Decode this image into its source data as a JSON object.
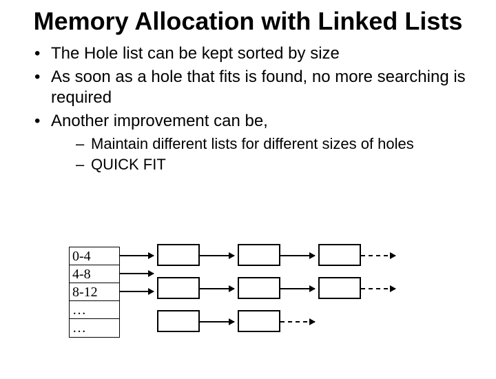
{
  "title": "Memory Allocation with Linked Lists",
  "bullets": [
    "The Hole list can be kept sorted by size",
    "As soon as a hole that fits is found, no more searching is required",
    "Another improvement can be,"
  ],
  "subbullets": [
    "Maintain different lists for different sizes of holes",
    "QUICK FIT"
  ],
  "size_table": [
    "0-4",
    "4-8",
    "8-12",
    "…",
    "…"
  ],
  "diagram": {
    "rows": [
      {
        "from_table_row": 0,
        "nodes": 3,
        "trailing_dashed": true
      },
      {
        "from_table_row": 1,
        "nodes": 3,
        "trailing_dashed": true
      },
      {
        "from_table_row": 2,
        "nodes": 2,
        "trailing_dashed": true
      }
    ]
  }
}
